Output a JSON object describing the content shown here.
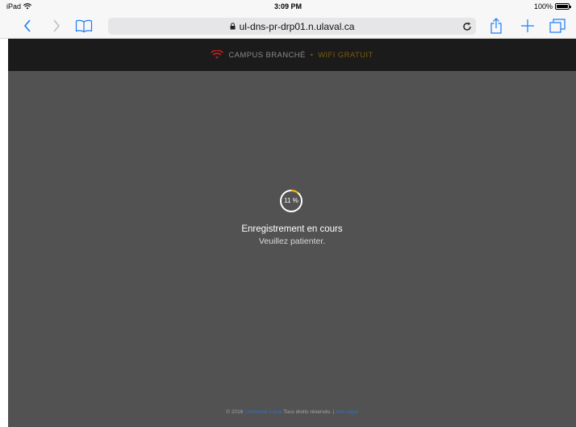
{
  "status_bar": {
    "device": "iPad",
    "time": "3:09 PM",
    "battery": "100%"
  },
  "browser": {
    "url": "ul-dns-pr-drp01.n.ulaval.ca"
  },
  "header": {
    "brand_main": "CAMPUS BRANCHÉ",
    "brand_separator": "•",
    "brand_accent": "WIFI GRATUIT",
    "accent_color": "#f0b400",
    "logo_color": "#b22222"
  },
  "progress": {
    "label": "11 %",
    "value": 11,
    "color": "#f0b400"
  },
  "message": {
    "title": "Enregistrement en cours",
    "subtitle": "Veuillez patienter."
  },
  "footer": {
    "copyright": "© 2016",
    "org_link": "Université Laval",
    "rights": "Tous droits réservés.",
    "separator": "|",
    "legal_link": "Avis légal"
  }
}
